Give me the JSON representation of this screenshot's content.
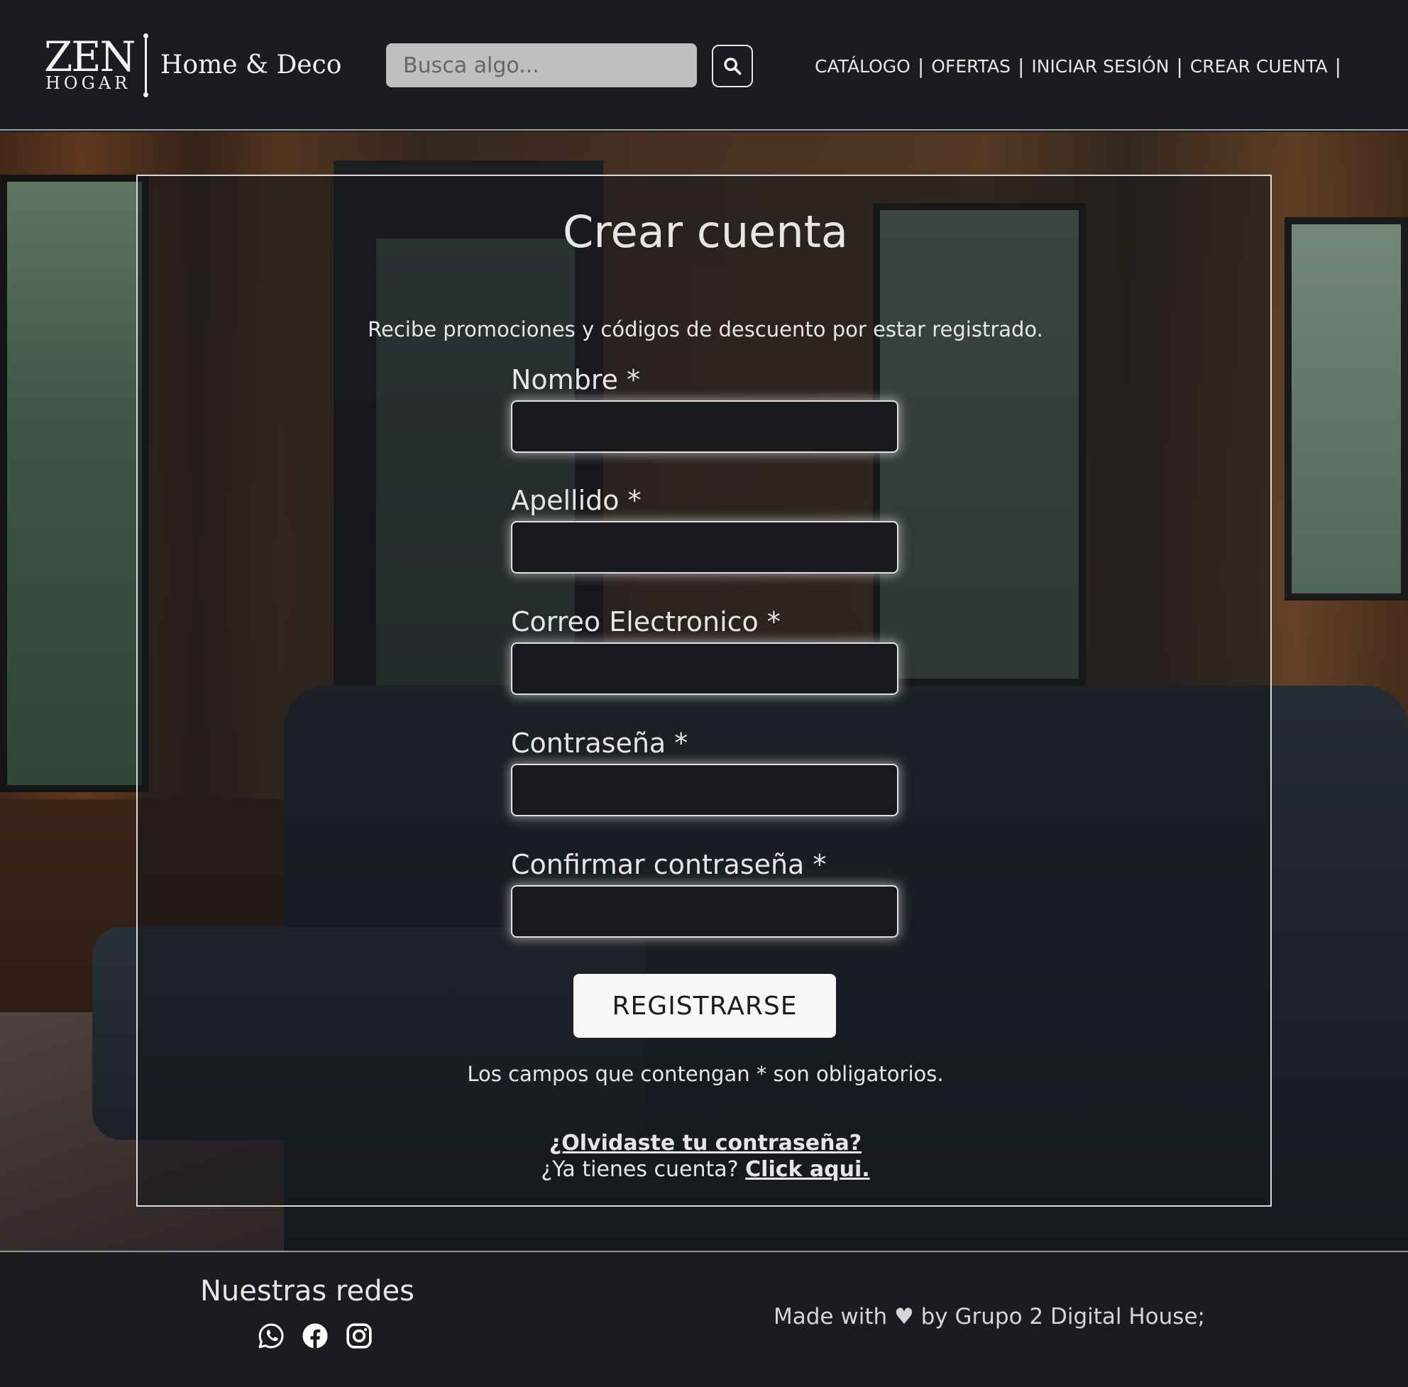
{
  "header": {
    "logo": {
      "brand": "ZEN",
      "brand_sub": "HOGAR",
      "tagline": "Home & Deco"
    },
    "search": {
      "placeholder": "Busca algo...",
      "value": "",
      "button_icon": "search-icon"
    },
    "nav": {
      "items": [
        "CATÁLOGO",
        "OFERTAS",
        "INICIAR SESIÓN",
        "CREAR CUENTA"
      ],
      "separator": "|"
    }
  },
  "form": {
    "title": "Crear cuenta",
    "subtitle": "Recibe promociones y códigos de descuento por estar registrado.",
    "fields": [
      {
        "label": "Nombre *",
        "value": ""
      },
      {
        "label": "Apellido *",
        "value": ""
      },
      {
        "label": "Correo Electronico *",
        "value": ""
      },
      {
        "label": "Contraseña *",
        "value": ""
      },
      {
        "label": "Confirmar contraseña *",
        "value": ""
      }
    ],
    "submit_label": "REGISTRARSE",
    "required_note": "Los campos que contengan * son obligatorios.",
    "forgot_password": "¿Olvidaste tu contraseña?",
    "have_account_text": "¿Ya tienes cuenta?",
    "login_link": "Click aqui."
  },
  "footer": {
    "social_heading": "Nuestras redes",
    "social_icons": [
      "whatsapp-icon",
      "facebook-icon",
      "instagram-icon"
    ],
    "credit": "Made with ♥ by Grupo 2 Digital House;"
  },
  "colors": {
    "background": "#1b1c20",
    "text": "#e6e6e6",
    "search_bg": "#bfbfbf",
    "button_bg": "#f7f7f7"
  }
}
